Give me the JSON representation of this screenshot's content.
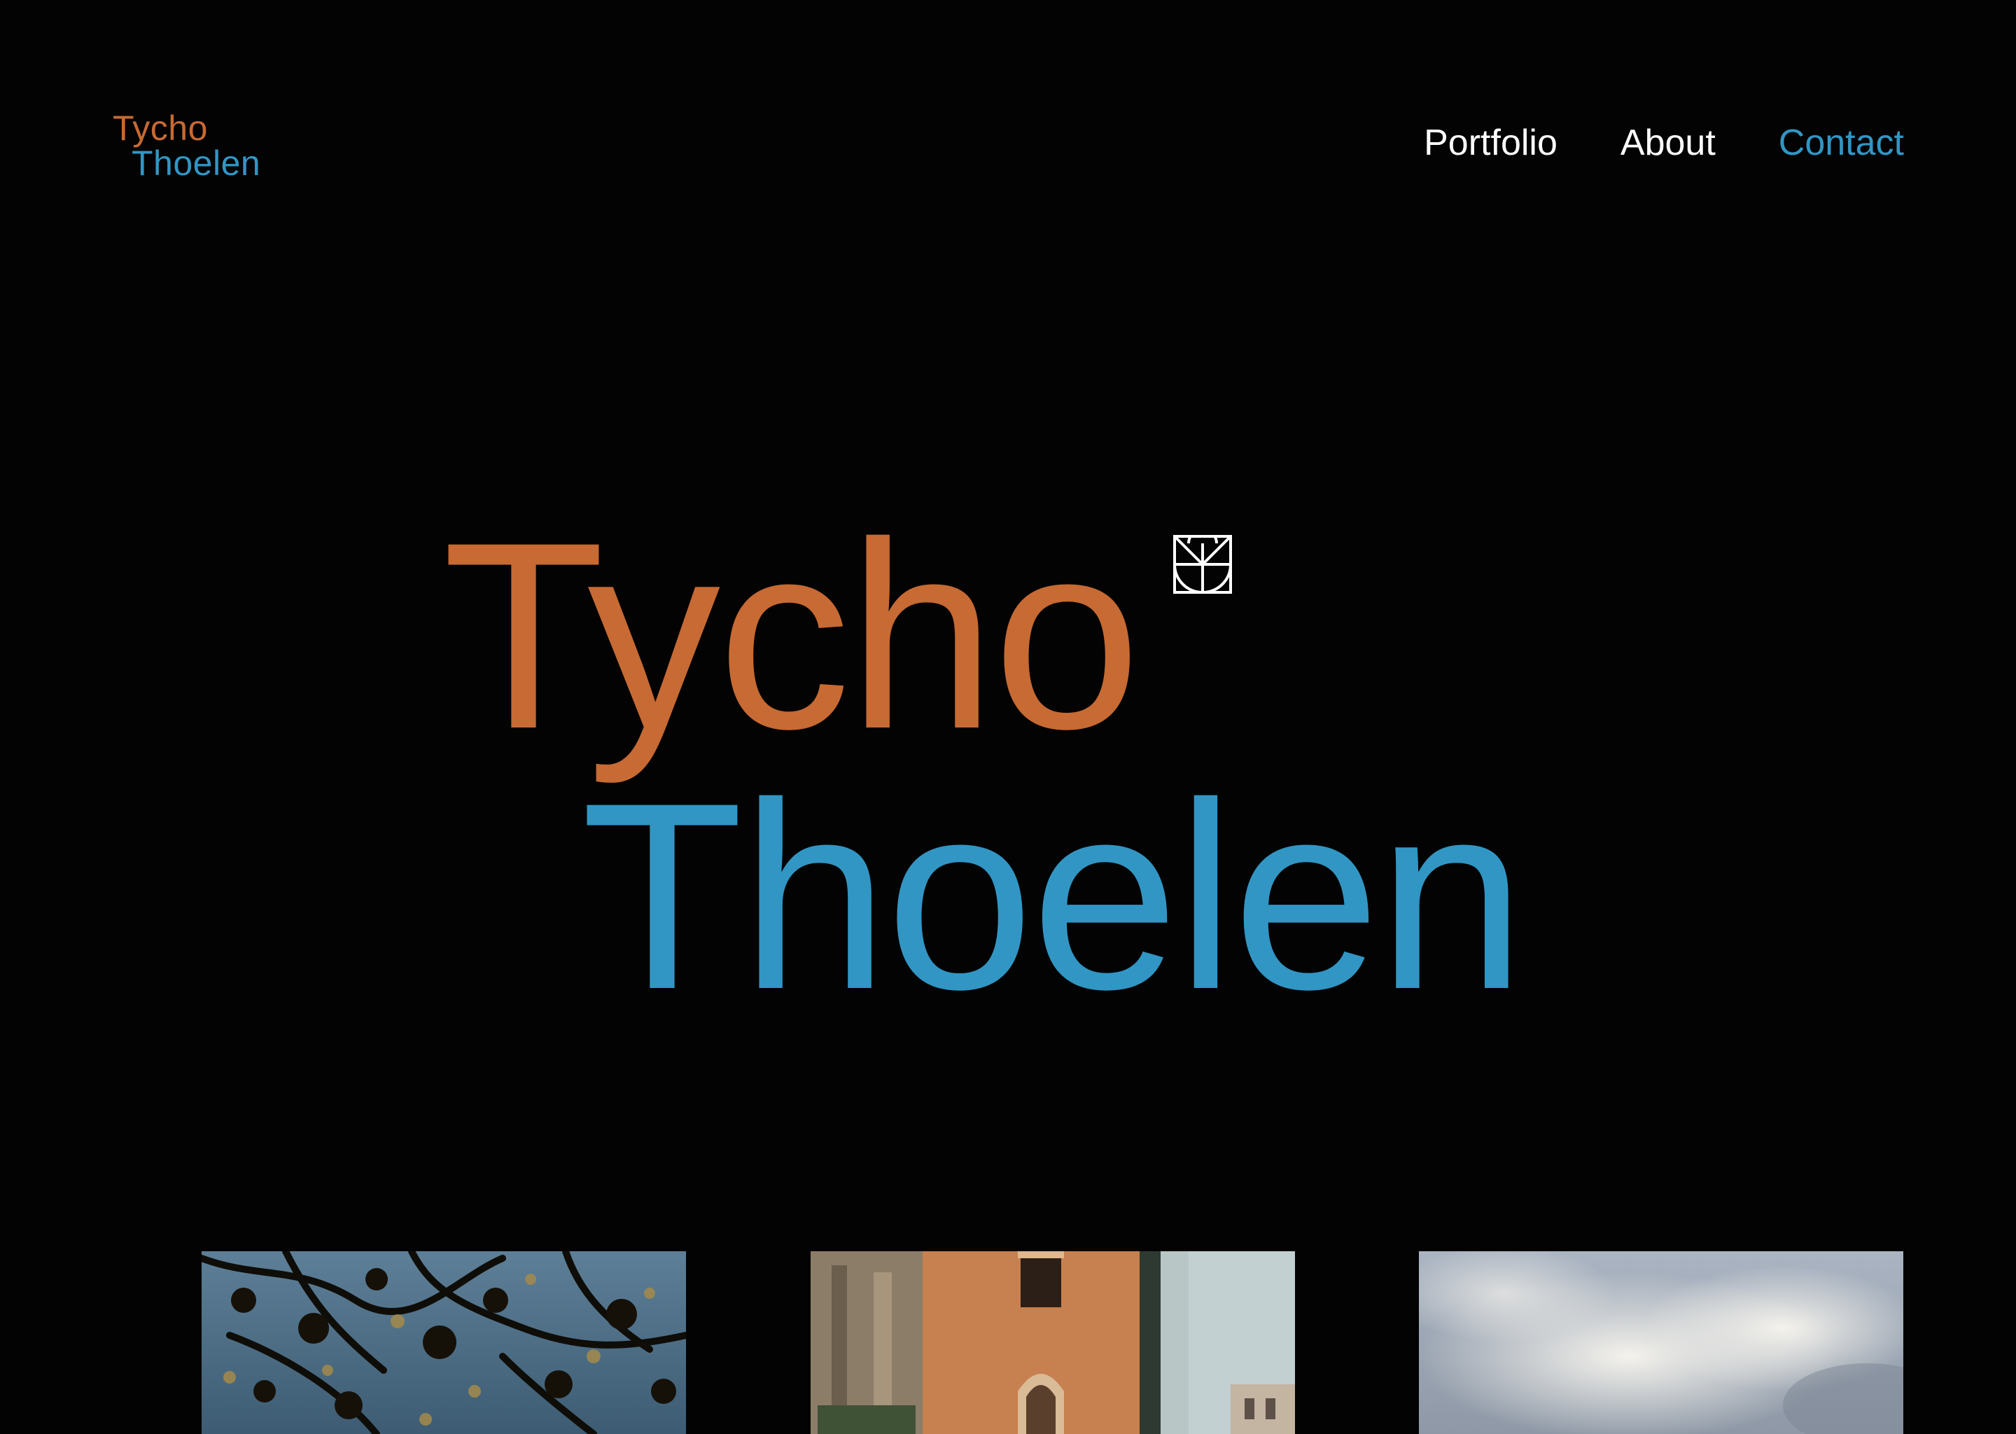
{
  "logo": {
    "first": "Tycho",
    "last": "Thoelen"
  },
  "nav": {
    "portfolio": "Portfolio",
    "about": "About",
    "contact": "Contact"
  },
  "hero": {
    "first": "Tycho",
    "last": "Thoelen",
    "mark_icon": "geometric-monogram-icon"
  },
  "colors": {
    "background": "#030303",
    "orange": "#c76a33",
    "blue": "#3196c4",
    "nav_text": "#ffffff"
  },
  "gallery": [
    {
      "name": "sea-through-branches-photo"
    },
    {
      "name": "venetian-building-photo"
    },
    {
      "name": "cloudy-sky-photo"
    }
  ]
}
